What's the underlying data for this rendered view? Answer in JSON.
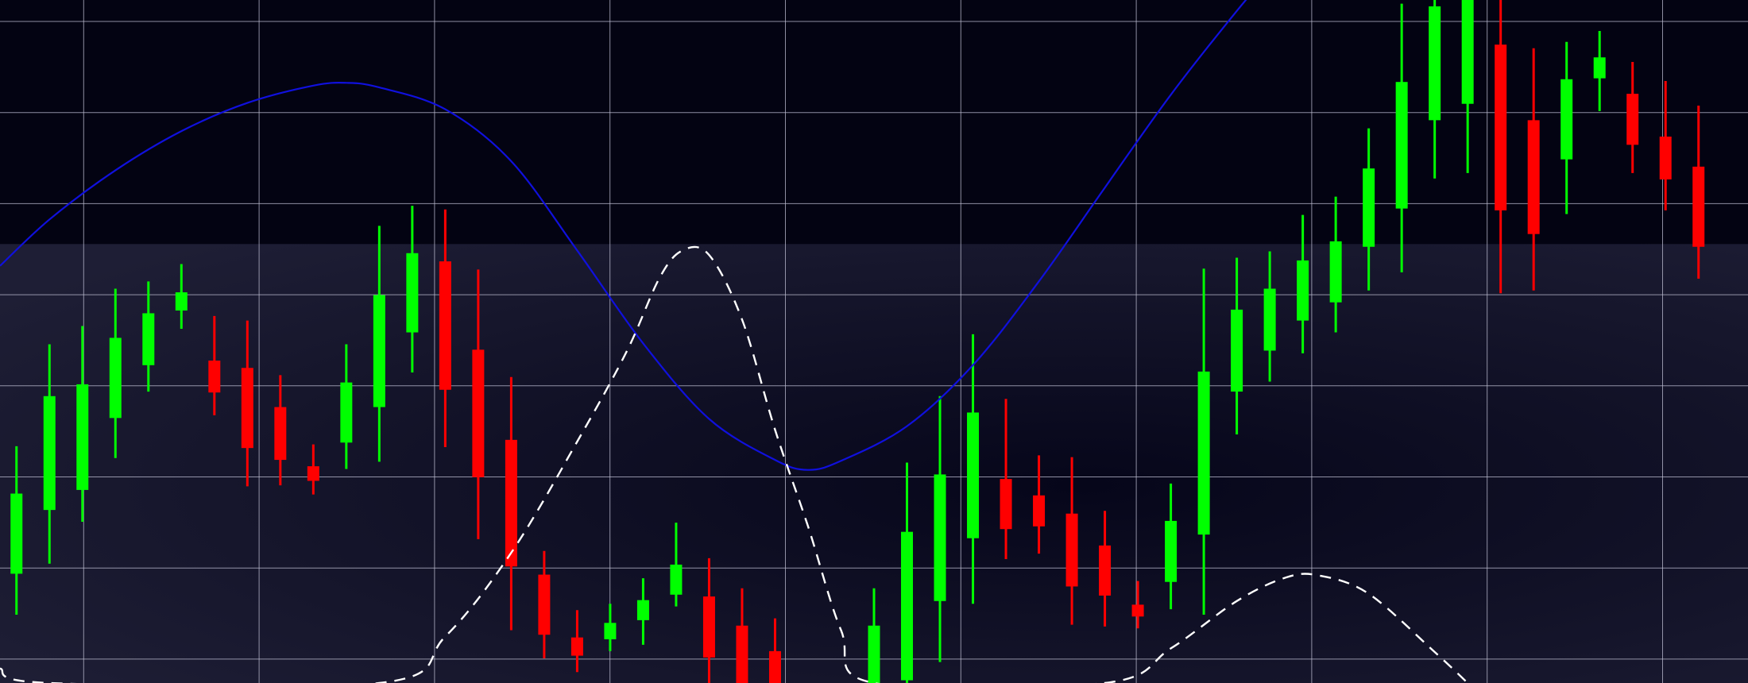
{
  "colors": {
    "background_top": "#030312",
    "background_lower": "#191930",
    "grid": "#bdbdd2",
    "up": "#00ff00",
    "down": "#ff0000",
    "ma_line": "#1010dd",
    "dashed_line": "#ffffff"
  },
  "chart_data": {
    "type": "candlestick",
    "title": "",
    "xlabel": "",
    "ylabel": "",
    "grid": true,
    "x_range": [
      0.5,
      53.5
    ],
    "y_range": [
      0,
      750
    ],
    "shaded_band_below": 482,
    "candles": [
      {
        "x": 1,
        "o": 120,
        "c": 208,
        "h": 260,
        "l": 75
      },
      {
        "x": 2,
        "o": 190,
        "c": 315,
        "h": 372,
        "l": 131
      },
      {
        "x": 3,
        "o": 212,
        "c": 328,
        "h": 392,
        "l": 177
      },
      {
        "x": 4,
        "o": 291,
        "c": 379,
        "h": 433,
        "l": 247
      },
      {
        "x": 5,
        "o": 349,
        "c": 406,
        "h": 441,
        "l": 320
      },
      {
        "x": 6,
        "o": 409,
        "c": 429,
        "h": 460,
        "l": 389
      },
      {
        "x": 7,
        "o": 354,
        "c": 319,
        "h": 403,
        "l": 294
      },
      {
        "x": 8,
        "o": 346,
        "c": 258,
        "h": 398,
        "l": 216
      },
      {
        "x": 9,
        "o": 303,
        "c": 245,
        "h": 338,
        "l": 217
      },
      {
        "x": 10,
        "o": 238,
        "c": 222,
        "h": 262,
        "l": 207
      },
      {
        "x": 11,
        "o": 264,
        "c": 330,
        "h": 372,
        "l": 235
      },
      {
        "x": 12,
        "o": 303,
        "c": 426,
        "h": 502,
        "l": 243
      },
      {
        "x": 13,
        "o": 385,
        "c": 472,
        "h": 524,
        "l": 341
      },
      {
        "x": 14,
        "o": 463,
        "c": 322,
        "h": 520,
        "l": 259
      },
      {
        "x": 15,
        "o": 366,
        "c": 226,
        "h": 454,
        "l": 158
      },
      {
        "x": 16,
        "o": 267,
        "c": 128,
        "h": 336,
        "l": 58
      },
      {
        "x": 17,
        "o": 119,
        "c": 53,
        "h": 145,
        "l": 27
      },
      {
        "x": 18,
        "o": 50,
        "c": 30,
        "h": 80,
        "l": 12
      },
      {
        "x": 19,
        "o": 48,
        "c": 66,
        "h": 87,
        "l": 35
      },
      {
        "x": 20,
        "o": 69,
        "c": 91,
        "h": 115,
        "l": 42
      },
      {
        "x": 21,
        "o": 97,
        "c": 130,
        "h": 176,
        "l": 84
      },
      {
        "x": 22,
        "o": 95,
        "c": 28,
        "h": 137,
        "l": 0
      },
      {
        "x": 23,
        "o": 63,
        "c": 0,
        "h": 104,
        "l": 0
      },
      {
        "x": 24,
        "o": 35,
        "c": 0,
        "h": 71,
        "l": 0
      },
      {
        "x": 27,
        "o": 0,
        "c": 63,
        "h": 104,
        "l": 0
      },
      {
        "x": 28,
        "o": 3,
        "c": 166,
        "h": 242,
        "l": 0
      },
      {
        "x": 29,
        "o": 90,
        "c": 229,
        "h": 315,
        "l": 23
      },
      {
        "x": 30,
        "o": 159,
        "c": 297,
        "h": 383,
        "l": 87
      },
      {
        "x": 31,
        "o": 224,
        "c": 169,
        "h": 312,
        "l": 136
      },
      {
        "x": 32,
        "o": 206,
        "c": 172,
        "h": 250,
        "l": 142
      },
      {
        "x": 33,
        "o": 186,
        "c": 106,
        "h": 248,
        "l": 64
      },
      {
        "x": 34,
        "o": 151,
        "c": 96,
        "h": 189,
        "l": 62
      },
      {
        "x": 35,
        "o": 86,
        "c": 73,
        "h": 112,
        "l": 60
      },
      {
        "x": 36,
        "o": 111,
        "c": 178,
        "h": 219,
        "l": 81
      },
      {
        "x": 37,
        "o": 163,
        "c": 342,
        "h": 455,
        "l": 75
      },
      {
        "x": 38,
        "o": 320,
        "c": 410,
        "h": 467,
        "l": 273
      },
      {
        "x": 39,
        "o": 365,
        "c": 433,
        "h": 474,
        "l": 331
      },
      {
        "x": 40,
        "o": 398,
        "c": 464,
        "h": 514,
        "l": 362
      },
      {
        "x": 41,
        "o": 418,
        "c": 485,
        "h": 534,
        "l": 385
      },
      {
        "x": 42,
        "o": 479,
        "c": 565,
        "h": 609,
        "l": 431
      },
      {
        "x": 43,
        "o": 521,
        "c": 660,
        "h": 746,
        "l": 451
      },
      {
        "x": 44,
        "o": 618,
        "c": 743,
        "h": 750,
        "l": 554
      },
      {
        "x": 45,
        "o": 636,
        "c": 750,
        "h": 750,
        "l": 560
      },
      {
        "x": 46,
        "o": 701,
        "c": 519,
        "h": 750,
        "l": 428
      },
      {
        "x": 47,
        "o": 618,
        "c": 493,
        "h": 697,
        "l": 431
      },
      {
        "x": 48,
        "o": 575,
        "c": 663,
        "h": 704,
        "l": 515
      },
      {
        "x": 49,
        "o": 664,
        "c": 687,
        "h": 716,
        "l": 628
      },
      {
        "x": 50,
        "o": 647,
        "c": 591,
        "h": 682,
        "l": 560
      },
      {
        "x": 51,
        "o": 600,
        "c": 553,
        "h": 661,
        "l": 519
      },
      {
        "x": 52,
        "o": 567,
        "c": 479,
        "h": 634,
        "l": 444
      }
    ],
    "ma_curve": [
      [
        0.5,
        458
      ],
      [
        2,
        509
      ],
      [
        4,
        563
      ],
      [
        6,
        606
      ],
      [
        8,
        637
      ],
      [
        10,
        656
      ],
      [
        11,
        659
      ],
      [
        12,
        654
      ],
      [
        14,
        630
      ],
      [
        16,
        573
      ],
      [
        18,
        475
      ],
      [
        20,
        373
      ],
      [
        22,
        290
      ],
      [
        24,
        245
      ],
      [
        25,
        234
      ],
      [
        26,
        244
      ],
      [
        28,
        282
      ],
      [
        30,
        349
      ],
      [
        32,
        441
      ],
      [
        34,
        544
      ],
      [
        36,
        646
      ],
      [
        38,
        738
      ],
      [
        39,
        780
      ],
      [
        40,
        820
      ]
    ],
    "dashed_curve": [
      [
        0.5,
        16
      ],
      [
        2,
        0
      ],
      [
        12,
        0
      ],
      [
        14,
        51
      ],
      [
        16,
        143
      ],
      [
        18,
        265
      ],
      [
        19.5,
        364
      ],
      [
        20.5,
        445
      ],
      [
        21.2,
        475
      ],
      [
        22,
        470
      ],
      [
        23,
        399
      ],
      [
        24,
        278
      ],
      [
        25,
        172
      ],
      [
        26,
        58
      ],
      [
        27,
        0
      ],
      [
        34,
        0
      ],
      [
        36,
        38
      ],
      [
        38,
        90
      ],
      [
        39.5,
        116
      ],
      [
        40.5,
        118
      ],
      [
        42,
        98
      ],
      [
        44,
        34
      ],
      [
        45,
        0
      ]
    ]
  }
}
